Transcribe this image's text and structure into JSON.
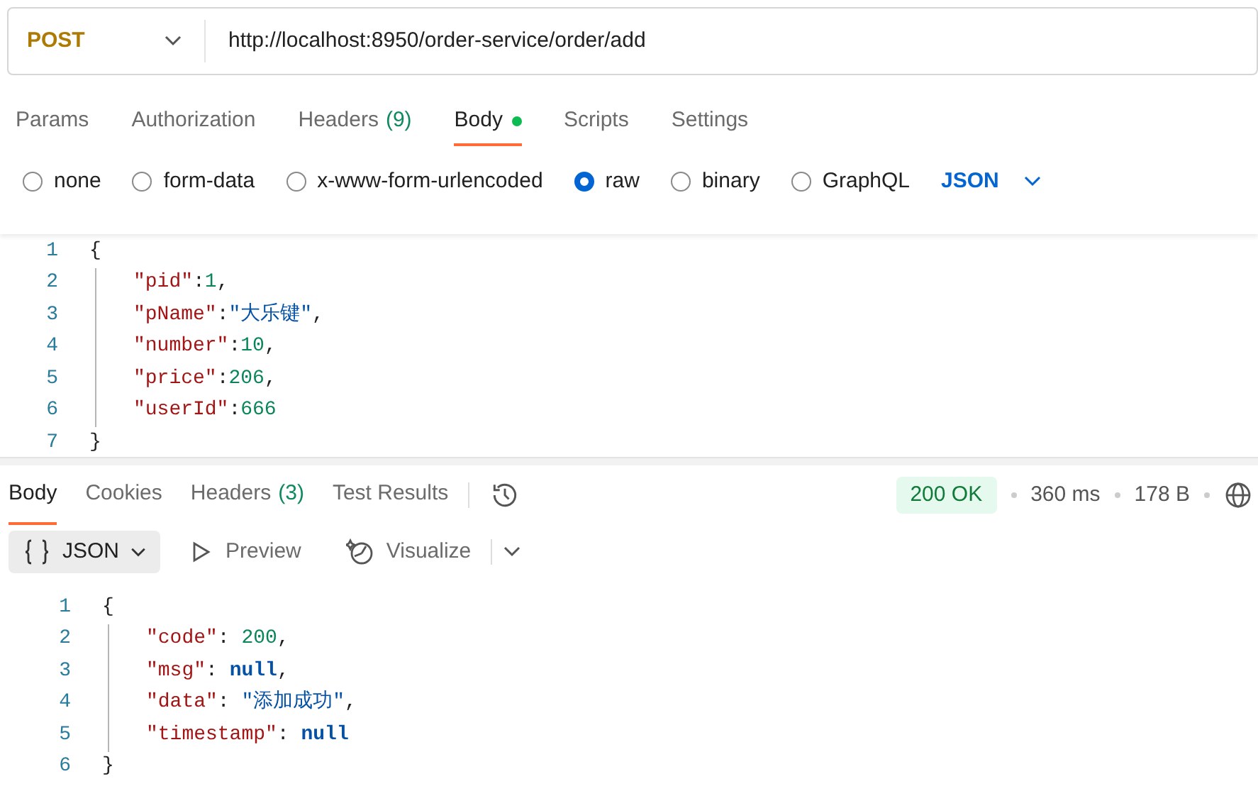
{
  "request": {
    "method": "POST",
    "url": "http://localhost:8950/order-service/order/add"
  },
  "request_tabs": [
    {
      "label": "Params",
      "selected": false
    },
    {
      "label": "Authorization",
      "selected": false
    },
    {
      "label": "Headers",
      "count": "(9)",
      "selected": false
    },
    {
      "label": "Body",
      "selected": true,
      "dot": true
    },
    {
      "label": "Scripts",
      "selected": false
    },
    {
      "label": "Settings",
      "selected": false
    }
  ],
  "body_types": [
    {
      "label": "none",
      "selected": false
    },
    {
      "label": "form-data",
      "selected": false
    },
    {
      "label": "x-www-form-urlencoded",
      "selected": false
    },
    {
      "label": "raw",
      "selected": true
    },
    {
      "label": "binary",
      "selected": false
    },
    {
      "label": "GraphQL",
      "selected": false
    }
  ],
  "body_format": "JSON",
  "request_body": [
    {
      "number": "1",
      "indented": false,
      "tokens": [
        {
          "kind": "punct",
          "text": "{"
        }
      ]
    },
    {
      "number": "2",
      "indented": true,
      "tokens": [
        {
          "kind": "key",
          "text": "\"pid\""
        },
        {
          "kind": "punct",
          "text": ":"
        },
        {
          "kind": "number",
          "text": "1"
        },
        {
          "kind": "punct",
          "text": ","
        }
      ]
    },
    {
      "number": "3",
      "indented": true,
      "tokens": [
        {
          "kind": "key",
          "text": "\"pName\""
        },
        {
          "kind": "punct",
          "text": ":"
        },
        {
          "kind": "string",
          "text": "\"大乐键\""
        },
        {
          "kind": "punct",
          "text": ","
        }
      ]
    },
    {
      "number": "4",
      "indented": true,
      "tokens": [
        {
          "kind": "key",
          "text": "\"number\""
        },
        {
          "kind": "punct",
          "text": ":"
        },
        {
          "kind": "number",
          "text": "10"
        },
        {
          "kind": "punct",
          "text": ","
        }
      ]
    },
    {
      "number": "5",
      "indented": true,
      "tokens": [
        {
          "kind": "key",
          "text": "\"price\""
        },
        {
          "kind": "punct",
          "text": ":"
        },
        {
          "kind": "number",
          "text": "206"
        },
        {
          "kind": "punct",
          "text": ","
        }
      ]
    },
    {
      "number": "6",
      "indented": true,
      "tokens": [
        {
          "kind": "key",
          "text": "\"userId\""
        },
        {
          "kind": "punct",
          "text": ":"
        },
        {
          "kind": "number",
          "text": "666"
        }
      ]
    },
    {
      "number": "7",
      "indented": false,
      "tokens": [
        {
          "kind": "punct",
          "text": "}"
        }
      ]
    }
  ],
  "response_tabs": [
    {
      "label": "Body",
      "selected": true
    },
    {
      "label": "Cookies",
      "selected": false
    },
    {
      "label": "Headers",
      "count": "(3)",
      "selected": false
    },
    {
      "label": "Test Results",
      "selected": false
    }
  ],
  "response_status": {
    "status": "200 OK",
    "time": "360 ms",
    "size": "178 B"
  },
  "response_views": [
    {
      "label": "JSON",
      "kind": "format",
      "selected": true
    },
    {
      "label": "Preview",
      "kind": "preview",
      "selected": false
    },
    {
      "label": "Visualize",
      "kind": "visualize",
      "selected": false
    }
  ],
  "response_body": [
    {
      "number": "1",
      "indented": false,
      "tokens": [
        {
          "kind": "punct",
          "text": "{"
        }
      ]
    },
    {
      "number": "2",
      "indented": true,
      "tokens": [
        {
          "kind": "key",
          "text": "\"code\""
        },
        {
          "kind": "punct",
          "text": ": "
        },
        {
          "kind": "number",
          "text": "200"
        },
        {
          "kind": "punct",
          "text": ","
        }
      ]
    },
    {
      "number": "3",
      "indented": true,
      "tokens": [
        {
          "kind": "key",
          "text": "\"msg\""
        },
        {
          "kind": "punct",
          "text": ": "
        },
        {
          "kind": "null",
          "text": "null"
        },
        {
          "kind": "punct",
          "text": ","
        }
      ]
    },
    {
      "number": "4",
      "indented": true,
      "tokens": [
        {
          "kind": "key",
          "text": "\"data\""
        },
        {
          "kind": "punct",
          "text": ": "
        },
        {
          "kind": "string",
          "text": "\"添加成功\""
        },
        {
          "kind": "punct",
          "text": ","
        }
      ]
    },
    {
      "number": "5",
      "indented": true,
      "tokens": [
        {
          "kind": "key",
          "text": "\"timestamp\""
        },
        {
          "kind": "punct",
          "text": ": "
        },
        {
          "kind": "null",
          "text": "null"
        }
      ]
    },
    {
      "number": "6",
      "indented": false,
      "tokens": [
        {
          "kind": "punct",
          "text": "}"
        }
      ]
    }
  ]
}
